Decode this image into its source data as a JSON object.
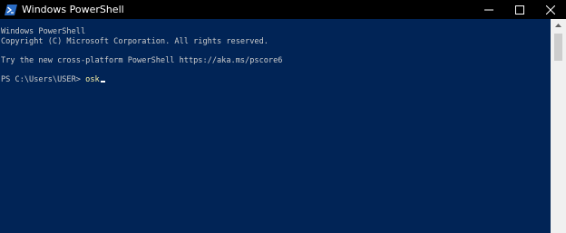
{
  "window": {
    "title": "Windows PowerShell",
    "icon": "powershell-icon",
    "controls": [
      "minimize-icon",
      "maximize-icon",
      "close-icon"
    ]
  },
  "console": {
    "background": "#012456",
    "text_color": "#cccccc",
    "command_color": "#f9f1a5",
    "lines": [
      "Windows PowerShell",
      "Copyright (C) Microsoft Corporation. All rights reserved.",
      "",
      "Try the new cross-platform PowerShell https://aka.ms/pscore6",
      ""
    ],
    "prompt": "PS C:\\Users\\USER> ",
    "command": "osk"
  }
}
